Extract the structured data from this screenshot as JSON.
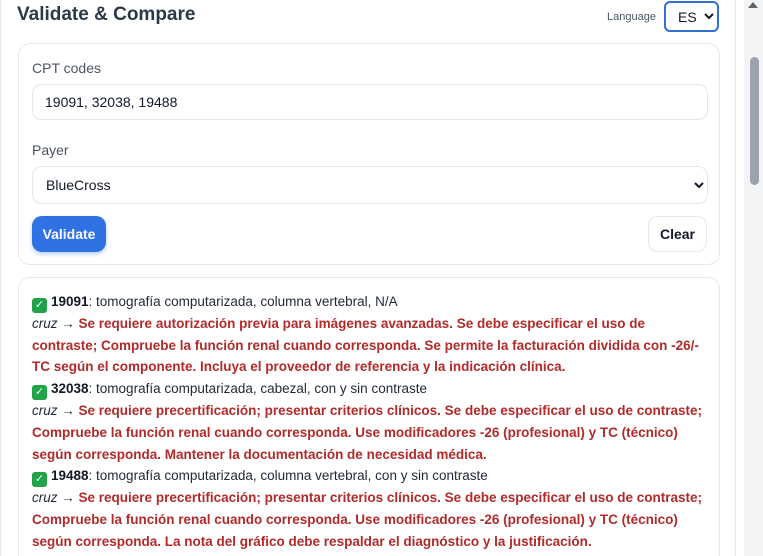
{
  "header": {
    "title": "Validate & Compare",
    "language_label": "Language",
    "language_value": "ES",
    "language_options": [
      "ES"
    ]
  },
  "form": {
    "cpt_label": "CPT codes",
    "cpt_value": "19091, 32038, 19488",
    "payer_label": "Payer",
    "payer_value": "BlueCross",
    "validate_label": "Validate",
    "clear_label": "Clear"
  },
  "results": [
    {
      "status": "ok",
      "code": "19091",
      "description": ": tomografía computarizada, columna vertebral, N/A",
      "payer": "cruz",
      "arrow": " → ",
      "note": "Se requiere autorización previa para imágenes avanzadas. Se debe especificar el uso de contraste; Compruebe la función renal cuando corresponda. Se permite la facturación dividida con -26/-TC según el componente. Incluya el proveedor de referencia y la indicación clínica."
    },
    {
      "status": "ok",
      "code": "32038",
      "description": ": tomografía computarizada, cabezal, con y sin contraste",
      "payer": "cruz",
      "arrow": " → ",
      "note": "Se requiere precertificación; presentar criterios clínicos. Se debe especificar el uso de contraste; Compruebe la función renal cuando corresponda. Use modificadores -26 (profesional) y TC (técnico) según corresponda. Mantener la documentación de necesidad médica."
    },
    {
      "status": "ok",
      "code": "19488",
      "description": ": tomografía computarizada, columna vertebral, con y sin contraste",
      "payer": "cruz",
      "arrow": " → ",
      "note": "Se requiere precertificación; presentar criterios clínicos. Se debe especificar el uso de contraste; Compruebe la función renal cuando corresponda. Use modificadores -26 (profesional) y TC (técnico) según corresponda. La nota del gráfico debe respaldar el diagnóstico y la justificación."
    }
  ],
  "colors": {
    "primary": "#2f72e4",
    "note_red": "#b22a2a",
    "check_green": "#21a34a"
  },
  "icons": {
    "status_ok": "check-mark-icon",
    "scroll_up": "scroll-up-arrow-icon"
  }
}
